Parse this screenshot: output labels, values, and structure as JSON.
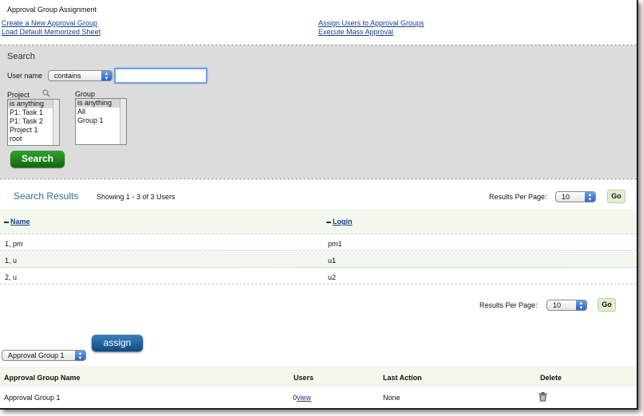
{
  "header": {
    "title": "Approval Group Assignment",
    "links": {
      "create_group": "Create a New Approval Group",
      "load_sheet": "Load Default Memorized Sheet",
      "assign_users": "Assign Users to Approval Groups",
      "mass_approval": "Execute Mass Approval"
    }
  },
  "search": {
    "heading": "Search",
    "username_label": "User name",
    "operator_value": "contains",
    "username_value": "",
    "project_label": "Project",
    "project_options": [
      "is anything",
      "P1: Task 1",
      "P1: Task 2",
      "Project 1",
      "root"
    ],
    "group_label": "Group",
    "group_options": [
      "is anything",
      "All",
      "Group 1"
    ],
    "search_button": "Search"
  },
  "results": {
    "title": "Search Results",
    "showing": "Showing 1 - 3 of 3 Users",
    "per_page_label": "Results Per Page:",
    "per_page_value": "10",
    "go_label": "Go",
    "columns": {
      "name": "Name",
      "login": "Login"
    },
    "rows": [
      {
        "name": "1, pm",
        "login": "pm1"
      },
      {
        "name": "1, u",
        "login": "u1"
      },
      {
        "name": "2, u",
        "login": "u2"
      }
    ]
  },
  "assign": {
    "group_select_value": "Approval Group 1",
    "assign_button": "assign"
  },
  "groups_table": {
    "columns": {
      "name": "Approval Group Name",
      "users": "Users",
      "last_action": "Last Action",
      "delete": "Delete"
    },
    "rows": [
      {
        "name": "Approval Group 1",
        "users_count": "0",
        "view_link": "view",
        "last_action": "None"
      }
    ]
  },
  "colors": {
    "link": "#1a3d8f",
    "search_panel": "#dcdcdc",
    "results_title": "#336e99",
    "search_button": "#1d861d",
    "assign_button": "#1f5d99",
    "row_alt": "#f2f8ec"
  },
  "icons": {
    "magnifier": "search-icon",
    "trash": "trash-icon",
    "sort": "sort-indicator-icon"
  }
}
